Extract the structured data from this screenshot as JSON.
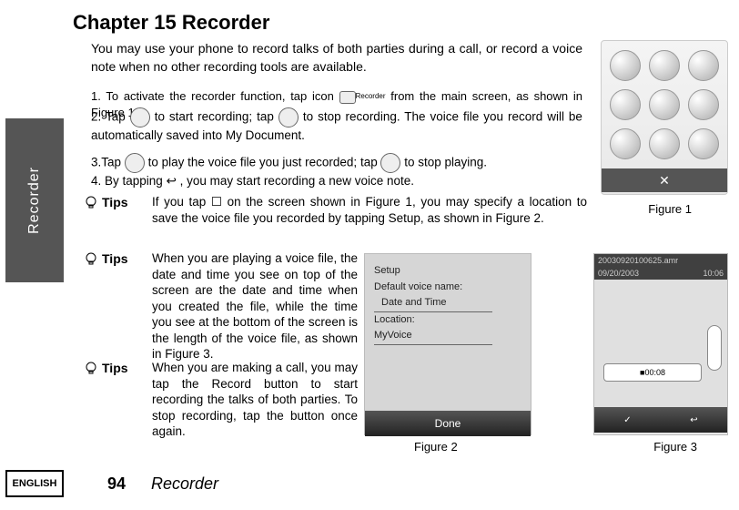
{
  "sidetab": "Recorder",
  "chapter_title": "Chapter 15 Recorder",
  "intro": "You may use your phone to record talks of both parties during a call, or record a voice note when no other recording tools are available.",
  "steps": {
    "s1_a": "1. To activate the recorder function, tap icon",
    "s1_b": "from the main screen, as shown in Figure 1.",
    "rec_label": "Recorder",
    "s2_a": "2. Tap",
    "s2_b": "to start recording; tap",
    "s2_c": "to stop recording. The voice file you record will be automatically saved into My Document.",
    "s3_a": "3.Tap",
    "s3_b": "to play the voice file you just recorded; tap",
    "s3_c": "to stop playing.",
    "s4_a": "4. By tapping",
    "s4_b": ", you may start recording a new voice note.",
    "arrow": "↩"
  },
  "tips_label": "Tips",
  "tips": {
    "t1": "If you tap ☐ on the screen shown in Figure 1, you may specify a location to save the voice file you recorded by tapping Setup, as shown in Figure 2.",
    "t2": "When you are playing a voice file, the date and time you see on top of the screen are the date and time when you created the file, while the time you see at the bottom of the screen is the length of the voice file, as shown in Figure 3.",
    "t3": "When you are making a call, you may tap the Record button to start recording the talks of both parties. To stop recording, tap the button once again."
  },
  "figures": {
    "f1": {
      "caption": "Figure 1",
      "close": "✕"
    },
    "f2": {
      "caption": "Figure 2",
      "setup": "Setup",
      "default_name": "Default voice name:",
      "date_time": "Date and Time",
      "location": "Location:",
      "myvoice": "MyVoice",
      "done": "Done"
    },
    "f3": {
      "caption": "Figure 3",
      "filename": "20030920100625.amr",
      "date": "09/20/2003",
      "time": "10:06",
      "elapsed": "00:08",
      "check": "✓",
      "back": "↩"
    }
  },
  "footer": {
    "lang": "ENGLISH",
    "page": "94",
    "title": "Recorder"
  }
}
